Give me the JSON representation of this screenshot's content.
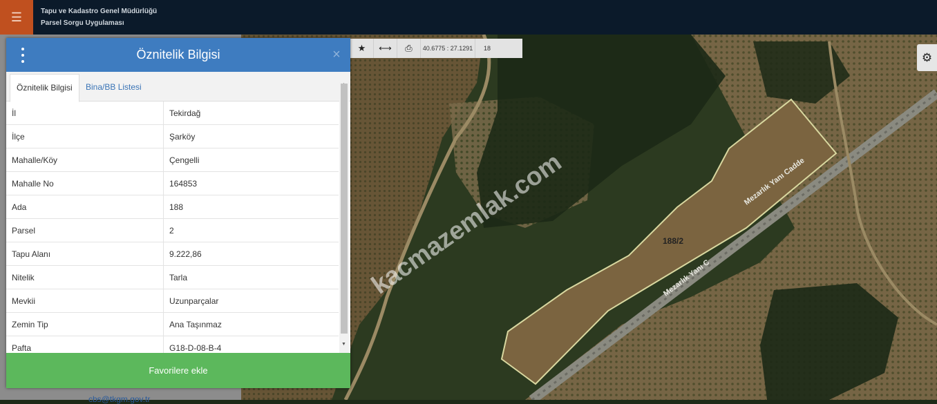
{
  "header": {
    "line1": "Tapu ve Kadastro Genel Müdürlüğü",
    "line2": "Parsel Sorgu Uygulaması",
    "menu_icon": "☰"
  },
  "toolbar": {
    "star_icon": "★",
    "measure_icon": "⟷",
    "print_icon": "⎙",
    "coords": "40.6775 : 27.1291",
    "zoom": "18"
  },
  "settings": {
    "gear_icon": "⚙"
  },
  "panel": {
    "title": "Öznitelik Bilgisi",
    "close": "×",
    "tabs": [
      "Öznitelik Bilgisi",
      "Bina/BB Listesi"
    ],
    "rows": [
      [
        "İl",
        "Tekirdağ"
      ],
      [
        "İlçe",
        "Şarköy"
      ],
      [
        "Mahalle/Köy",
        "Çengelli"
      ],
      [
        "Mahalle No",
        "164853"
      ],
      [
        "Ada",
        "188"
      ],
      [
        "Parsel",
        "2"
      ],
      [
        "Tapu Alanı",
        "9.222,86"
      ],
      [
        "Nitelik",
        "Tarla"
      ],
      [
        "Mevkii",
        "Uzunparçalar"
      ],
      [
        "Zemin Tip",
        "Ana Taşınmaz"
      ],
      [
        "Pafta",
        "G18-D-08-B-4"
      ]
    ],
    "favorite_button": "Favorilere ekle"
  },
  "map": {
    "parcel_label": "188/2",
    "road_label_1": "Mezarlık Yanı Cadde",
    "road_label_2": "Mezarlık Yanı C",
    "watermark": "kacmazemlak.com"
  },
  "footer": {
    "email": "cbs@tkgm.gov.tr"
  }
}
